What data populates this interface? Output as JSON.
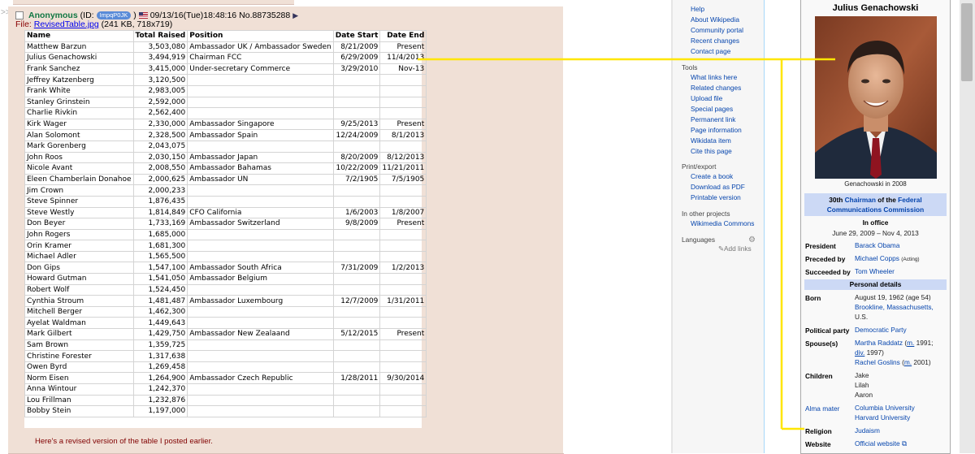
{
  "post": {
    "quote_marker": ">>",
    "name": "Anonymous",
    "id_prefix": "(ID:",
    "id": "ImpqP0JK",
    "id_suffix": ")",
    "datetime": "09/13/16(Tue)18:48:16",
    "number": "No.88735288",
    "arrow": "▶",
    "file_label": "File:",
    "file_name": "RevisedTable.jpg",
    "file_meta": "(241 KB, 718x719)",
    "comment": "Here's a revised version of the table I posted earlier.",
    "table": {
      "headers": [
        "Name",
        "Total Raised",
        "Position",
        "Date Start",
        "Date End"
      ],
      "rows": [
        [
          "Matthew Barzun",
          "3,503,080",
          "Ambassador UK / Ambassador Sweden",
          "8/21/2009",
          "Present"
        ],
        [
          "Julius Genachowski",
          "3,494,919",
          "Chairman FCC",
          "6/29/2009",
          "11/4/2013"
        ],
        [
          "Frank Sanchez",
          "3,415,000",
          "Under-secretary Commerce",
          "3/29/2010",
          "Nov-13"
        ],
        [
          "Jeffrey Katzenberg",
          "3,120,500",
          "",
          "",
          ""
        ],
        [
          "Frank White",
          "2,983,005",
          "",
          "",
          ""
        ],
        [
          "Stanley Grinstein",
          "2,592,000",
          "",
          "",
          ""
        ],
        [
          "Charlie Rivkin",
          "2,562,400",
          "",
          "",
          ""
        ],
        [
          "Kirk Wager",
          "2,330,000",
          "Ambassador Singapore",
          "9/25/2013",
          "Present"
        ],
        [
          "Alan Solomont",
          "2,328,500",
          "Ambassador Spain",
          "12/24/2009",
          "8/1/2013"
        ],
        [
          "Mark Gorenberg",
          "2,043,075",
          "",
          "",
          ""
        ],
        [
          "John Roos",
          "2,030,150",
          "Ambassador Japan",
          "8/20/2009",
          "8/12/2013"
        ],
        [
          "Nicole Avant",
          "2,008,550",
          "Ambassador Bahamas",
          "10/22/2009",
          "11/21/2011"
        ],
        [
          "Eleen Chamberlain Donahoe",
          "2,000,625",
          "Ambassador UN",
          "7/2/1905",
          "7/5/1905"
        ],
        [
          "Jim Crown",
          "2,000,233",
          "",
          "",
          ""
        ],
        [
          "Steve Spinner",
          "1,876,435",
          "",
          "",
          ""
        ],
        [
          "Steve Westly",
          "1,814,849",
          "CFO California",
          "1/6/2003",
          "1/8/2007"
        ],
        [
          "Don Beyer",
          "1,733,169",
          "Ambassador Switzerland",
          "9/8/2009",
          "Present"
        ],
        [
          "John Rogers",
          "1,685,000",
          "",
          "",
          ""
        ],
        [
          "Orin Kramer",
          "1,681,300",
          "",
          "",
          ""
        ],
        [
          "Michael Adler",
          "1,565,500",
          "",
          "",
          ""
        ],
        [
          "Don Gips",
          "1,547,100",
          "Ambassador South Africa",
          "7/31/2009",
          "1/2/2013"
        ],
        [
          "Howard Gutman",
          "1,541,050",
          "Ambassador Belgium",
          "",
          ""
        ],
        [
          "Robert Wolf",
          "1,524,450",
          "",
          "",
          ""
        ],
        [
          "Cynthia Stroum",
          "1,481,487",
          "Ambassador Luxembourg",
          "12/7/2009",
          "1/31/2011"
        ],
        [
          "Mitchell Berger",
          "1,462,300",
          "",
          "",
          ""
        ],
        [
          "Ayelat Waldman",
          "1,449,643",
          "",
          "",
          ""
        ],
        [
          "Mark Gilbert",
          "1,429,750",
          "Ambassador New Zealaand",
          "5/12/2015",
          "Present"
        ],
        [
          "Sam Brown",
          "1,359,725",
          "",
          "",
          ""
        ],
        [
          "Christine Forester",
          "1,317,638",
          "",
          "",
          ""
        ],
        [
          "Owen Byrd",
          "1,269,458",
          "",
          "",
          ""
        ],
        [
          "Norm Eisen",
          "1,264,900",
          "Ambassador Czech Republic",
          "1/28/2011",
          "9/30/2014"
        ],
        [
          "Anna Wintour",
          "1,242,370",
          "",
          "",
          ""
        ],
        [
          "Lou Frillman",
          "1,232,876",
          "",
          "",
          ""
        ],
        [
          "Bobby Stein",
          "1,197,000",
          "",
          "",
          ""
        ]
      ]
    }
  },
  "wiki_sidebar": {
    "top_links": [
      "Help",
      "About Wikipedia",
      "Community portal",
      "Recent changes",
      "Contact page"
    ],
    "tools_heading": "Tools",
    "tools_links": [
      "What links here",
      "Related changes",
      "Upload file",
      "Special pages",
      "Permanent link",
      "Page information",
      "Wikidata item",
      "Cite this page"
    ],
    "print_heading": "Print/export",
    "print_links": [
      "Create a book",
      "Download as PDF",
      "Printable version"
    ],
    "other_heading": "In other projects",
    "other_links": [
      "Wikimedia Commons"
    ],
    "languages_heading": "Languages",
    "add_links": "Add links"
  },
  "infobox": {
    "title": "Julius Genachowski",
    "caption": "Genachowski in 2008",
    "office_ordinal": "30th",
    "office_link": "Chairman",
    "office_of": "of the",
    "office_org": "Federal Communications Commission",
    "in_office_label": "In office",
    "term": "June 29, 2009 – Nov 4, 2013",
    "president_label": "President",
    "president": "Barack Obama",
    "preceded_label": "Preceded by",
    "preceded": "Michael Copps",
    "preceded_note": "(Acting)",
    "succeeded_label": "Succeeded by",
    "succeeded": "Tom Wheeler",
    "personal_header": "Personal details",
    "born_label": "Born",
    "born_date": "August 19, 1962 (age 54)",
    "born_place": "Brookline, Massachusetts,",
    "born_country": "U.S.",
    "party_label": "Political party",
    "party": "Democratic Party",
    "spouse_label": "Spouse(s)",
    "spouse1": "Martha Raddatz",
    "spouse1_m": "m.",
    "spouse1_year": "1991;",
    "spouse1_div": "div.",
    "spouse1_end": "1997)",
    "spouse2": "Rachel Goslins",
    "spouse2_m": "m.",
    "spouse2_year": "2001)",
    "children_label": "Children",
    "children": [
      "Jake",
      "Lilah",
      "Aaron"
    ],
    "alma_label": "Alma mater",
    "alma": [
      "Columbia University",
      "Harvard University"
    ],
    "religion_label": "Religion",
    "religion": "Judaism",
    "website_label": "Website",
    "website": "Official website"
  },
  "colors": {
    "connector": "#ffe600",
    "post_bg": "#f0e0d6",
    "name_green": "#117743",
    "wiki_link": "#0645ad",
    "infobox_header": "#ccd9f5"
  }
}
